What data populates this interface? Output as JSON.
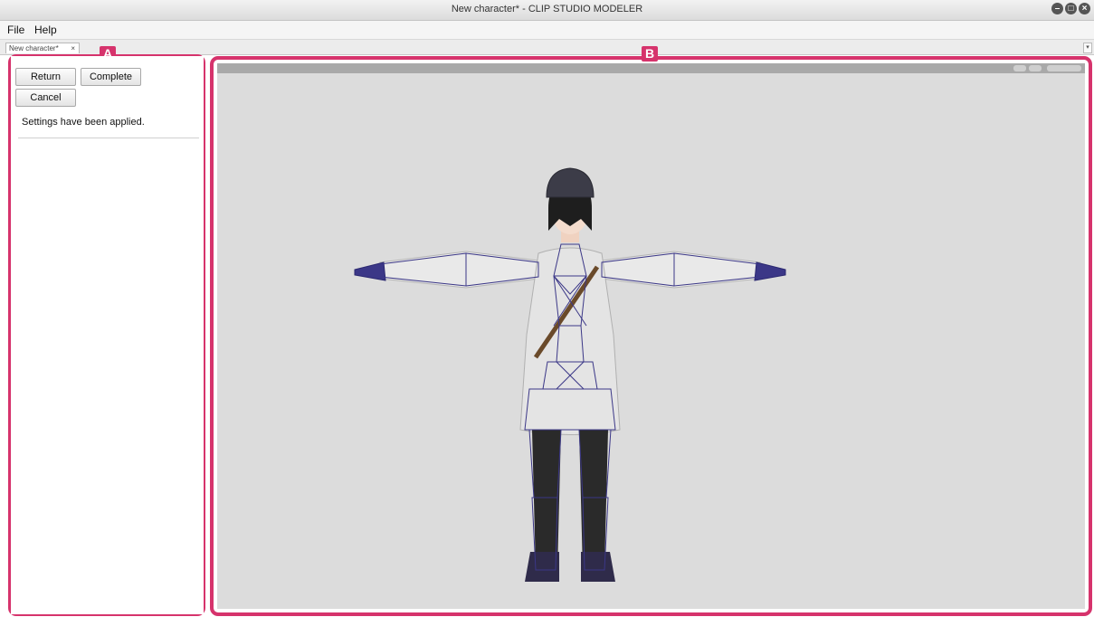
{
  "window": {
    "title": "New character* - CLIP STUDIO MODELER",
    "controls": [
      "minimize-icon",
      "maximize-icon",
      "close-icon"
    ]
  },
  "menu": {
    "items": [
      {
        "label": "File"
      },
      {
        "label": "Help"
      }
    ]
  },
  "document_tab": {
    "label": "New character*",
    "close_glyph": "×"
  },
  "callouts": {
    "a": "A",
    "b": "B"
  },
  "panel": {
    "buttons": {
      "return": "Return",
      "complete": "Complete",
      "cancel": "Cancel"
    },
    "status_message": "Settings have been applied."
  },
  "viewport": {
    "toolbar_icons": [
      "camera-rotate-icon",
      "camera-pan-icon",
      "display-mode-icon"
    ]
  },
  "colors": {
    "callout": "#d6336c",
    "wireframe": "#3b3787",
    "viewport_bg": "#dcdcdc"
  }
}
